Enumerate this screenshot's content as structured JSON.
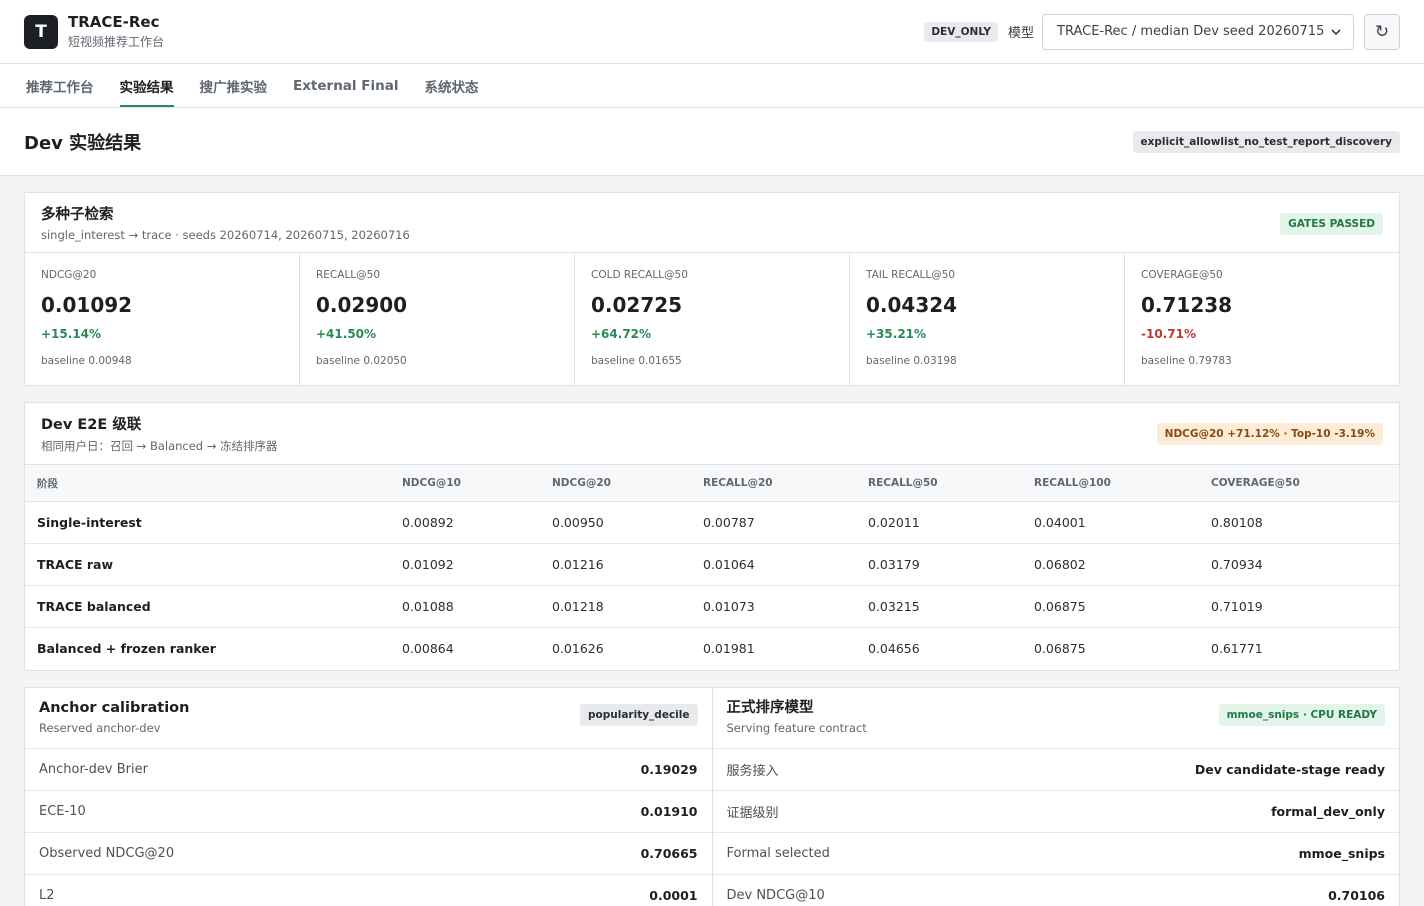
{
  "app": {
    "logo_letter": "T",
    "title": "TRACE-Rec",
    "subtitle": "短视频推荐工作台",
    "env_badge": "DEV_ONLY",
    "model_label": "模型",
    "model_selected": "TRACE-Rec / median Dev seed 20260715",
    "refresh_glyph": "↻"
  },
  "tabs": [
    {
      "label": "推荐工作台",
      "active": false
    },
    {
      "label": "实验结果",
      "active": true
    },
    {
      "label": "搜广推实验",
      "active": false
    },
    {
      "label": "External Final",
      "active": false
    },
    {
      "label": "系统状态",
      "active": false
    }
  ],
  "page": {
    "title": "Dev 实验结果",
    "policy_tag": "explicit_allowlist_no_test_report_discovery"
  },
  "multi_seed": {
    "title": "多种子检索",
    "subtitle": "single_interest → trace · seeds 20260714, 20260715, 20260716",
    "status": "GATES PASSED",
    "metrics": [
      {
        "label": "NDCG@20",
        "value": "0.01092",
        "delta": "+15.14%",
        "direction": "pos",
        "baseline": "baseline 0.00948"
      },
      {
        "label": "RECALL@50",
        "value": "0.02900",
        "delta": "+41.50%",
        "direction": "pos",
        "baseline": "baseline 0.02050"
      },
      {
        "label": "COLD RECALL@50",
        "value": "0.02725",
        "delta": "+64.72%",
        "direction": "pos",
        "baseline": "baseline 0.01655"
      },
      {
        "label": "TAIL RECALL@50",
        "value": "0.04324",
        "delta": "+35.21%",
        "direction": "pos",
        "baseline": "baseline 0.03198"
      },
      {
        "label": "COVERAGE@50",
        "value": "0.71238",
        "delta": "-10.71%",
        "direction": "neg",
        "baseline": "baseline 0.79783"
      }
    ]
  },
  "e2e": {
    "title": "Dev E2E 级联",
    "subtitle": "相同用户日：召回 → Balanced → 冻结排序器",
    "summary": "NDCG@20 +71.12% · Top-10 -3.19%",
    "columns": [
      "阶段",
      "NDCG@10",
      "NDCG@20",
      "RECALL@20",
      "RECALL@50",
      "RECALL@100",
      "COVERAGE@50"
    ],
    "rows": [
      [
        "Single-interest",
        "0.00892",
        "0.00950",
        "0.00787",
        "0.02011",
        "0.04001",
        "0.80108"
      ],
      [
        "TRACE raw",
        "0.01092",
        "0.01216",
        "0.01064",
        "0.03179",
        "0.06802",
        "0.70934"
      ],
      [
        "TRACE balanced",
        "0.01088",
        "0.01218",
        "0.01073",
        "0.03215",
        "0.06875",
        "0.71019"
      ],
      [
        "Balanced + frozen ranker",
        "0.00864",
        "0.01626",
        "0.01981",
        "0.04656",
        "0.06875",
        "0.61771"
      ]
    ]
  },
  "anchor": {
    "title": "Anchor calibration",
    "subtitle": "Reserved anchor-dev",
    "tag": "popularity_decile",
    "items": [
      {
        "key": "Anchor-dev Brier",
        "value": "0.19029"
      },
      {
        "key": "ECE-10",
        "value": "0.01910"
      },
      {
        "key": "Observed NDCG@20",
        "value": "0.70665"
      },
      {
        "key": "L2",
        "value": "0.0001"
      }
    ]
  },
  "ranker": {
    "title": "正式排序模型",
    "subtitle": "Serving feature contract",
    "tag": "mmoe_snips · CPU READY",
    "items": [
      {
        "key": "服务接入",
        "value": "Dev candidate-stage ready"
      },
      {
        "key": "证据级别",
        "value": "formal_dev_only"
      },
      {
        "key": "Formal selected",
        "value": "mmoe_snips"
      },
      {
        "key": "Dev NDCG@10",
        "value": "0.70106"
      }
    ]
  }
}
